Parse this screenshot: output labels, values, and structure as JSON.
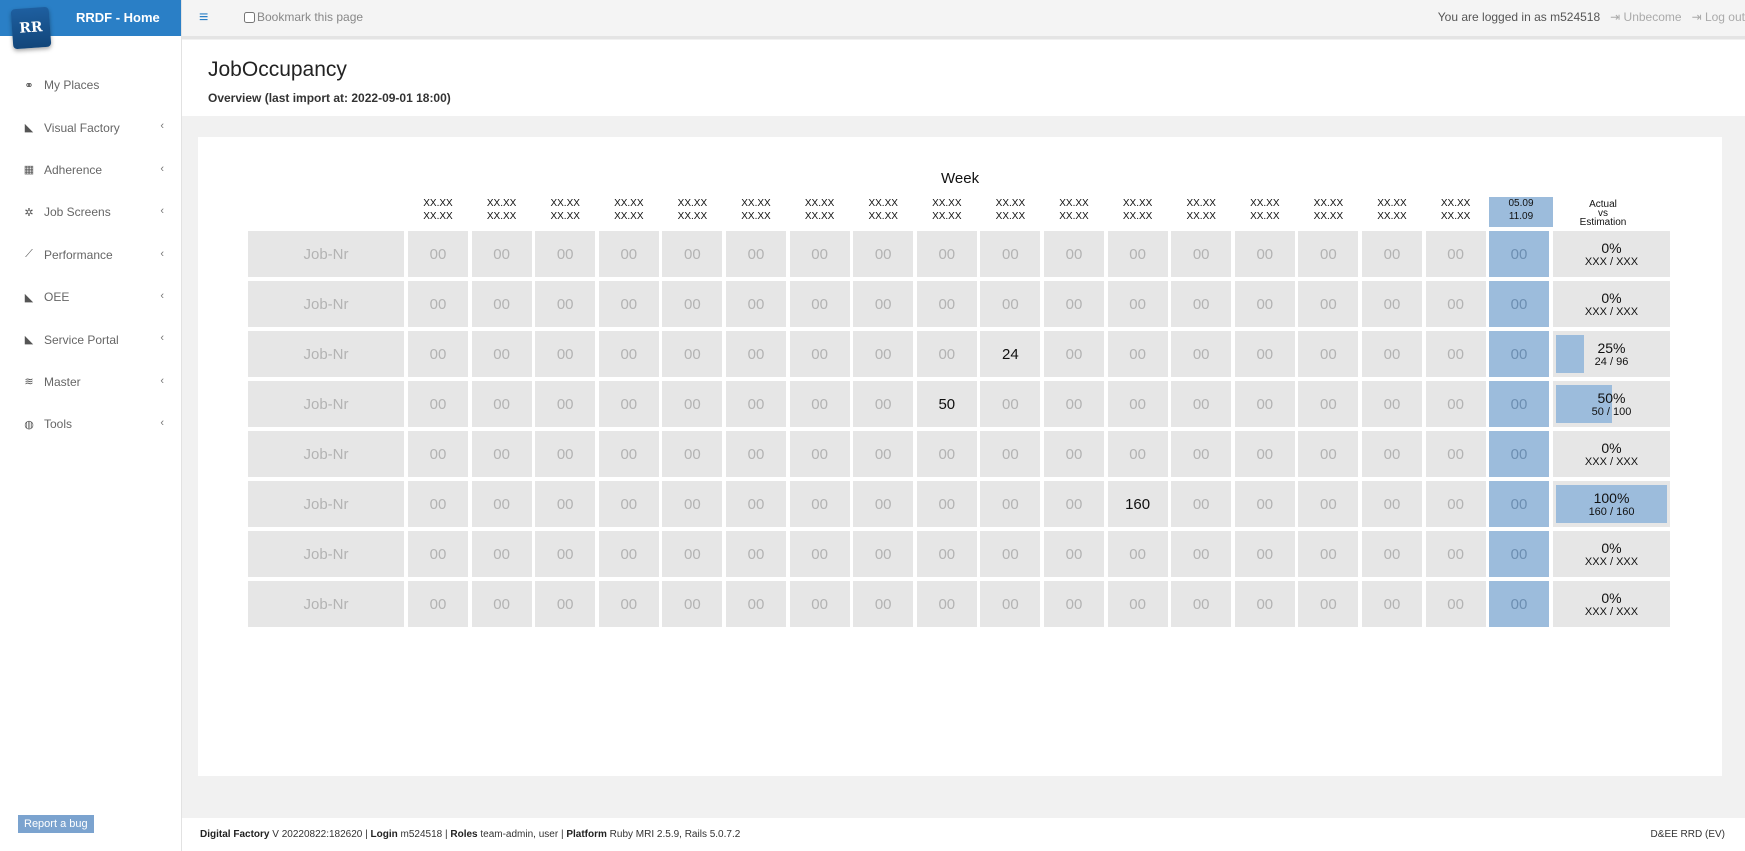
{
  "brand": {
    "title": "RRDF - Home",
    "logo_text": "RR"
  },
  "sidebar": {
    "items": [
      {
        "label": "My Places",
        "icon": "link-icon",
        "glyph": "⚭",
        "has_submenu": false
      },
      {
        "label": "Visual Factory",
        "icon": "area-chart-icon",
        "glyph": "◣",
        "has_submenu": true
      },
      {
        "label": "Adherence",
        "icon": "table-icon",
        "glyph": "▦",
        "has_submenu": true
      },
      {
        "label": "Job Screens",
        "icon": "gear-icon",
        "glyph": "✲",
        "has_submenu": true
      },
      {
        "label": "Performance",
        "icon": "line-chart-icon",
        "glyph": "⟋",
        "has_submenu": true
      },
      {
        "label": "OEE",
        "icon": "area-chart-icon",
        "glyph": "◣",
        "has_submenu": true
      },
      {
        "label": "Service Portal",
        "icon": "area-chart-icon",
        "glyph": "◣",
        "has_submenu": true
      },
      {
        "label": "Master",
        "icon": "database-icon",
        "glyph": "≋",
        "has_submenu": true
      },
      {
        "label": "Tools",
        "icon": "globe-icon",
        "glyph": "◍",
        "has_submenu": true
      }
    ],
    "chevron": "‹",
    "report_bug": "Report a bug"
  },
  "topbar": {
    "menu_glyph": "≡",
    "bookmark_label": "Bookmark this page",
    "logged_in_text": "You are logged in as m524518",
    "unbecome": "⇥ Unbecome",
    "logout": "⇥ Log out"
  },
  "header": {
    "title": "JobOccupancy",
    "subtitle": "Overview  (last import at: 2022-09-01 18:00)"
  },
  "grid": {
    "week_label": "Week",
    "week_headers": [
      [
        "XX.XX",
        "XX.XX"
      ],
      [
        "XX.XX",
        "XX.XX"
      ],
      [
        "XX.XX",
        "XX.XX"
      ],
      [
        "XX.XX",
        "XX.XX"
      ],
      [
        "XX.XX",
        "XX.XX"
      ],
      [
        "XX.XX",
        "XX.XX"
      ],
      [
        "XX.XX",
        "XX.XX"
      ],
      [
        "XX.XX",
        "XX.XX"
      ],
      [
        "XX.XX",
        "XX.XX"
      ],
      [
        "XX.XX",
        "XX.XX"
      ],
      [
        "XX.XX",
        "XX.XX"
      ],
      [
        "XX.XX",
        "XX.XX"
      ],
      [
        "XX.XX",
        "XX.XX"
      ],
      [
        "XX.XX",
        "XX.XX"
      ],
      [
        "XX.XX",
        "XX.XX"
      ],
      [
        "XX.XX",
        "XX.XX"
      ],
      [
        "XX.XX",
        "XX.XX"
      ]
    ],
    "current_week": [
      "05.09",
      "11.09"
    ],
    "actual_header": [
      "Actual",
      "vs",
      "Estimation"
    ],
    "rows": [
      {
        "job": "Job-Nr",
        "weeks": [
          "00",
          "00",
          "00",
          "00",
          "00",
          "00",
          "00",
          "00",
          "00",
          "00",
          "00",
          "00",
          "00",
          "00",
          "00",
          "00",
          "00"
        ],
        "current": "00",
        "pct": "0%",
        "frac": "XXX / XXX",
        "fill": 0,
        "filled_index": -1
      },
      {
        "job": "Job-Nr",
        "weeks": [
          "00",
          "00",
          "00",
          "00",
          "00",
          "00",
          "00",
          "00",
          "00",
          "00",
          "00",
          "00",
          "00",
          "00",
          "00",
          "00",
          "00"
        ],
        "current": "00",
        "pct": "0%",
        "frac": "XXX / XXX",
        "fill": 0,
        "filled_index": -1
      },
      {
        "job": "Job-Nr",
        "weeks": [
          "00",
          "00",
          "00",
          "00",
          "00",
          "00",
          "00",
          "00",
          "00",
          "24",
          "00",
          "00",
          "00",
          "00",
          "00",
          "00",
          "00"
        ],
        "current": "00",
        "pct": "25%",
        "frac": "24 / 96",
        "fill": 0.25,
        "filled_index": 9
      },
      {
        "job": "Job-Nr",
        "weeks": [
          "00",
          "00",
          "00",
          "00",
          "00",
          "00",
          "00",
          "00",
          "50",
          "00",
          "00",
          "00",
          "00",
          "00",
          "00",
          "00",
          "00"
        ],
        "current": "00",
        "pct": "50%",
        "frac": "50 / 100",
        "fill": 0.5,
        "filled_index": 8
      },
      {
        "job": "Job-Nr",
        "weeks": [
          "00",
          "00",
          "00",
          "00",
          "00",
          "00",
          "00",
          "00",
          "00",
          "00",
          "00",
          "00",
          "00",
          "00",
          "00",
          "00",
          "00"
        ],
        "current": "00",
        "pct": "0%",
        "frac": "XXX / XXX",
        "fill": 0,
        "filled_index": -1
      },
      {
        "job": "Job-Nr",
        "weeks": [
          "00",
          "00",
          "00",
          "00",
          "00",
          "00",
          "00",
          "00",
          "00",
          "00",
          "00",
          "160",
          "00",
          "00",
          "00",
          "00",
          "00"
        ],
        "current": "00",
        "pct": "100%",
        "frac": "160 / 160",
        "fill": 1,
        "filled_index": 11
      },
      {
        "job": "Job-Nr",
        "weeks": [
          "00",
          "00",
          "00",
          "00",
          "00",
          "00",
          "00",
          "00",
          "00",
          "00",
          "00",
          "00",
          "00",
          "00",
          "00",
          "00",
          "00"
        ],
        "current": "00",
        "pct": "0%",
        "frac": "XXX / XXX",
        "fill": 0,
        "filled_index": -1
      },
      {
        "job": "Job-Nr",
        "weeks": [
          "00",
          "00",
          "00",
          "00",
          "00",
          "00",
          "00",
          "00",
          "00",
          "00",
          "00",
          "00",
          "00",
          "00",
          "00",
          "00",
          "00"
        ],
        "current": "00",
        "pct": "0%",
        "frac": "XXX / XXX",
        "fill": 0,
        "filled_index": -1
      }
    ]
  },
  "footer": {
    "app_label": "Digital Factory",
    "version": " V 20220822:182620 | ",
    "login_label": "Login",
    "login": " m524518 | ",
    "roles_label": "Roles",
    "roles": " team-admin, user | ",
    "platform_label": "Platform",
    "platform": " Ruby MRI 2.5.9, Rails 5.0.7.2",
    "right": "D&EE RRD (EV)"
  },
  "colors": {
    "brand": "#2a7fc6",
    "current_week": "#9cbcdc",
    "cell": "#e6e6e6",
    "report_button": "#7ba3cf"
  }
}
